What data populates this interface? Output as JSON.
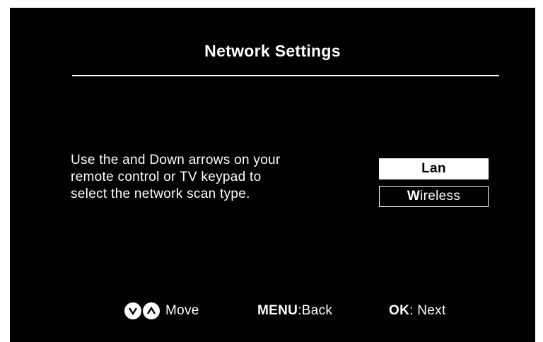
{
  "header": {
    "title": "Network Settings"
  },
  "instructions": {
    "line1": "Use the and Down arrows on your",
    "line2": "remote control or TV keypad to",
    "line3": "select the network scan type."
  },
  "options": [
    {
      "label": "Lan",
      "selected": true
    },
    {
      "label": "Wireless",
      "selected": false
    }
  ],
  "footer": {
    "move_label": "Move",
    "menu_key": "MENU",
    "menu_action": ":Back",
    "ok_key": "OK",
    "ok_action": ": Next",
    "icons": [
      "down-arrow-icon",
      "up-arrow-icon"
    ]
  },
  "colors": {
    "background": "#000000",
    "text": "#ffffff",
    "selected_bg": "#ffffff",
    "selected_text": "#000000"
  }
}
